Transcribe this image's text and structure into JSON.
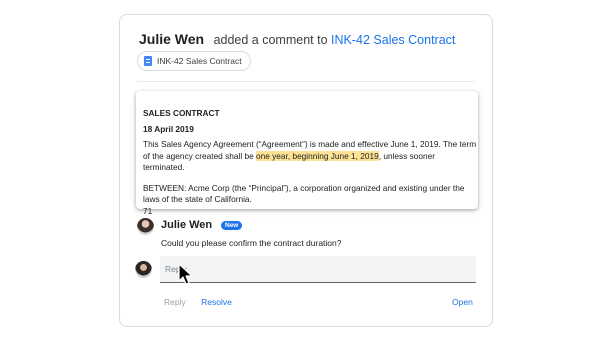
{
  "header": {
    "author": "Julie Wen",
    "verb": "added a comment to",
    "doc_link": "INK-42 Sales Contract"
  },
  "chip": {
    "icon": "doc-icon",
    "label": "INK-42 Sales Contract"
  },
  "document": {
    "title": "SALES CONTRACT",
    "date": "18 April 2019",
    "para1_before": "This Sales Agency Agreement (“Agreement”) is made and effective June 1, 2019. The term of the agency created shall be ",
    "para1_highlight": "one year, beginning June 1, 2019",
    "para1_after": ", unless sooner terminated.",
    "para2": "BETWEEN: Acme Corp (the “Principal”), a corporation organized and existing under the laws of the state of California.",
    "footer_number": "71"
  },
  "comment": {
    "author": "Julie Wen",
    "badge": "New",
    "body": "Could you please confirm the contract duration?"
  },
  "reply": {
    "placeholder": "Reply"
  },
  "actions": {
    "reply_label": "Reply",
    "resolve_label": "Resolve",
    "open_label": "Open"
  },
  "colors": {
    "accent": "#1a73e8",
    "highlight": "#fde293"
  }
}
